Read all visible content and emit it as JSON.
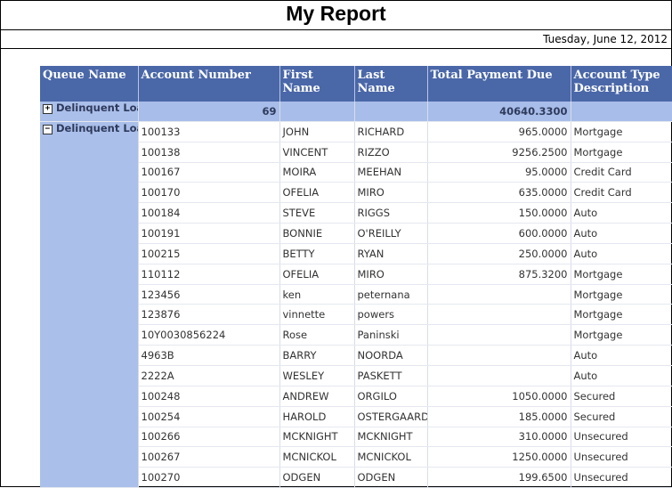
{
  "report": {
    "title": "My Report",
    "date": "Tuesday, June 12, 2012"
  },
  "columns": [
    "Queue Name",
    "Account Number",
    "First Name",
    "Last Name",
    "Total Payment Due",
    "Account Type Description"
  ],
  "groups": [
    {
      "name": "Delinquent Loans - A to F",
      "expand_icon": "plus-box-icon",
      "account_count": "69",
      "total_payment_due": "40640.3300"
    },
    {
      "name": "Delinquent Loans - M to R",
      "expand_icon": "minus-box-icon"
    }
  ],
  "rows": [
    {
      "account": "100133",
      "first": "JOHN",
      "last": "RICHARD",
      "due": "965.0000",
      "type": "Mortgage"
    },
    {
      "account": "100138",
      "first": "VINCENT",
      "last": "RIZZO",
      "due": "9256.2500",
      "type": "Mortgage"
    },
    {
      "account": "100167",
      "first": "MOIRA",
      "last": "MEEHAN",
      "due": "95.0000",
      "type": "Credit Card"
    },
    {
      "account": "100170",
      "first": "OFELIA",
      "last": "MIRO",
      "due": "635.0000",
      "type": "Credit Card"
    },
    {
      "account": "100184",
      "first": "STEVE",
      "last": "RIGGS",
      "due": "150.0000",
      "type": "Auto"
    },
    {
      "account": "100191",
      "first": "BONNIE",
      "last": "O'REILLY",
      "due": "600.0000",
      "type": "Auto"
    },
    {
      "account": "100215",
      "first": "BETTY",
      "last": "RYAN",
      "due": "250.0000",
      "type": "Auto"
    },
    {
      "account": "110112",
      "first": "OFELIA",
      "last": "MIRO",
      "due": "875.3200",
      "type": "Mortgage"
    },
    {
      "account": "123456",
      "first": "ken",
      "last": "peternana",
      "due": "",
      "type": "Mortgage"
    },
    {
      "account": "123876",
      "first": "vinnette",
      "last": "powers",
      "due": "",
      "type": "Mortgage"
    },
    {
      "account": "10Y0030856224",
      "first": "Rose",
      "last": "Paninski",
      "due": "",
      "type": "Mortgage"
    },
    {
      "account": "4963B",
      "first": "BARRY",
      "last": "NOORDA",
      "due": "",
      "type": "Auto"
    },
    {
      "account": "2222A",
      "first": "WESLEY",
      "last": "PASKETT",
      "due": "",
      "type": "Auto"
    },
    {
      "account": "100248",
      "first": "ANDREW",
      "last": "ORGILO",
      "due": "1050.0000",
      "type": "Secured"
    },
    {
      "account": "100254",
      "first": "HAROLD",
      "last": "OSTERGAARD",
      "due": "185.0000",
      "type": "Secured"
    },
    {
      "account": "100266",
      "first": "MCKNIGHT",
      "last": "MCKNIGHT",
      "due": "310.0000",
      "type": "Unsecured"
    },
    {
      "account": "100267",
      "first": "MCNICKOL",
      "last": "MCNICKOL",
      "due": "1250.0000",
      "type": "Unsecured"
    },
    {
      "account": "100270",
      "first": "ODGEN",
      "last": "ODGEN",
      "due": "199.6500",
      "type": "Unsecured"
    }
  ]
}
